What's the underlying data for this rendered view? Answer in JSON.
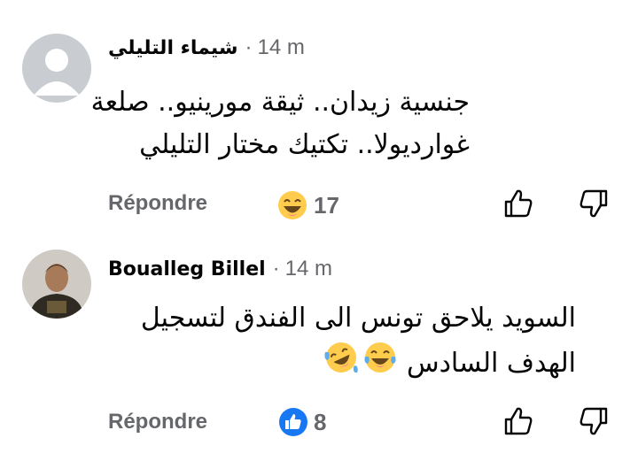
{
  "comments": [
    {
      "author": "شيماء التليلي",
      "separator": "·",
      "time": "14 m",
      "text_line1": "جنسية زيدان.. ثيقة مورينيو.. صلعة",
      "text_line2": "غوارديولا.. تكتيك مختار التليلي",
      "reply_label": "Répondre",
      "reaction_icon": "laughing-emoji",
      "reaction_count": "17"
    },
    {
      "author": "Boualleg Billel",
      "separator": "·",
      "time": "14 m",
      "text_line1": "السويد يلاحق تونس الى الفندق  لتسجيل",
      "text_line2": "الهدف السادس",
      "reply_label": "Répondre",
      "reaction_icon": "like-icon",
      "reaction_count": "8"
    }
  ],
  "colors": {
    "primary_text": "#050505",
    "secondary_text": "#65676b",
    "like_blue": "#1877f2",
    "emoji_yellow": "#ffcc4d"
  }
}
